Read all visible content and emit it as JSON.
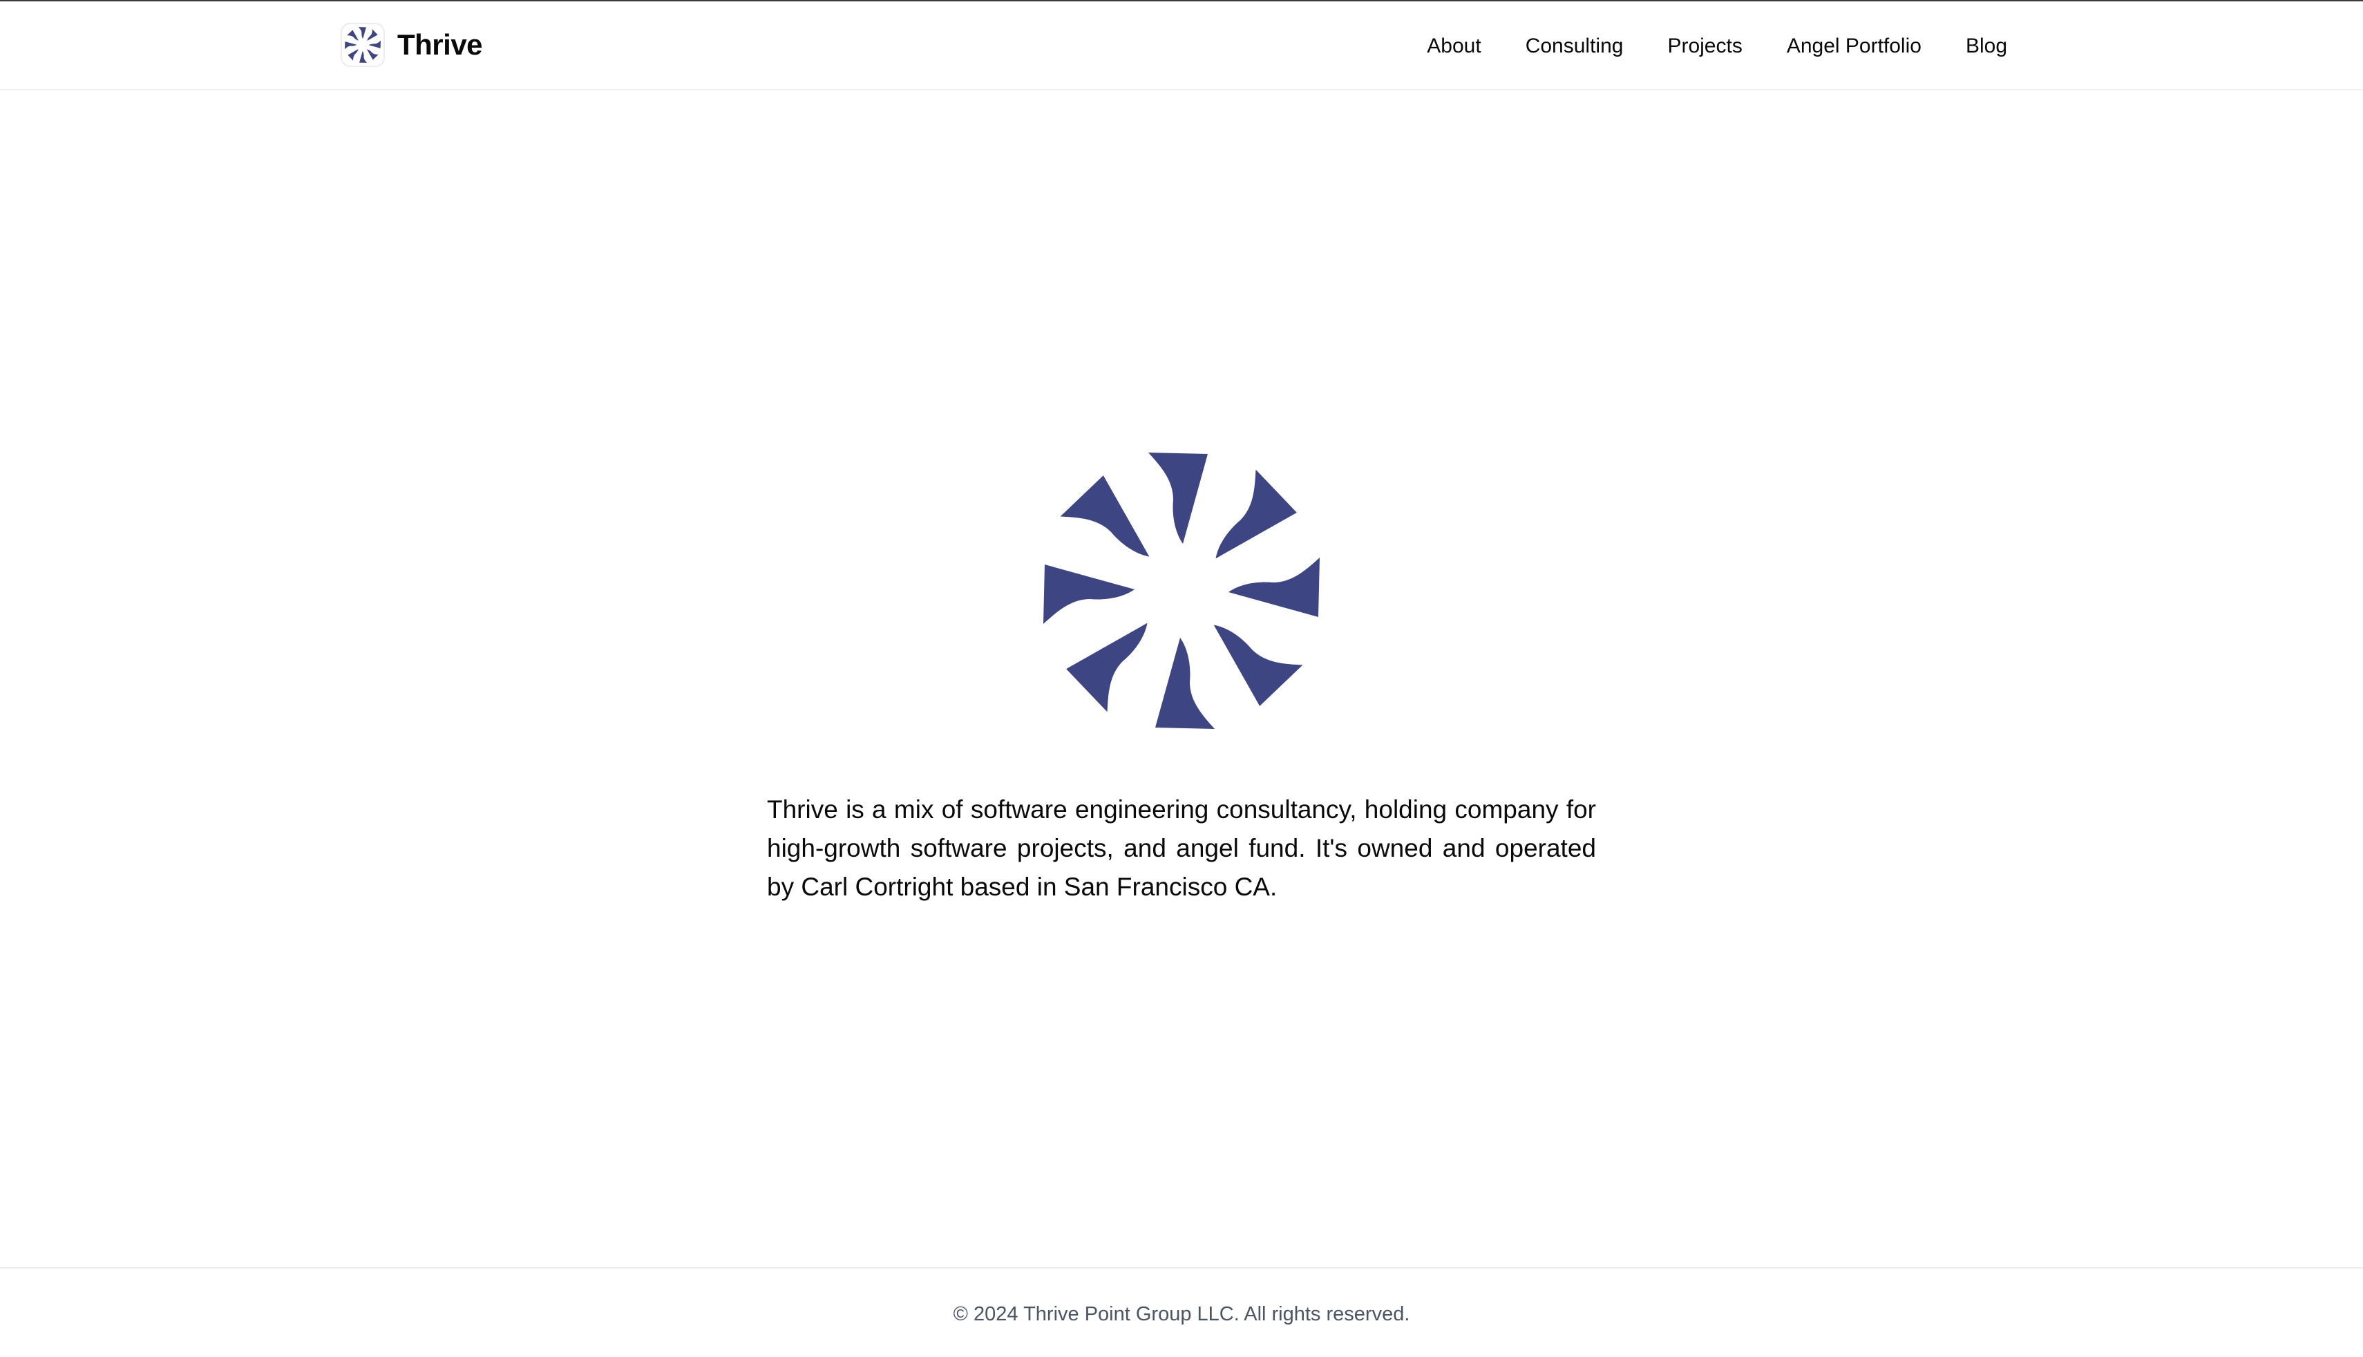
{
  "header": {
    "brand_name": "Thrive",
    "nav": {
      "about": "About",
      "consulting": "Consulting",
      "projects": "Projects",
      "angel_portfolio": "Angel Portfolio",
      "blog": "Blog"
    }
  },
  "main": {
    "description": "Thrive is a mix of software engineering consultancy, holding company for high-growth software projects, and angel fund. It's owned and operated by Carl Cortright based in San Francisco CA.",
    "logo_icon": "pinwheel-logo-icon"
  },
  "footer": {
    "copyright": "© 2024 Thrive Point Group LLC. All rights reserved."
  },
  "colors": {
    "brand": "#3d4682",
    "text": "#0a0a0a",
    "muted": "#4b5563",
    "divider": "#ececec"
  }
}
